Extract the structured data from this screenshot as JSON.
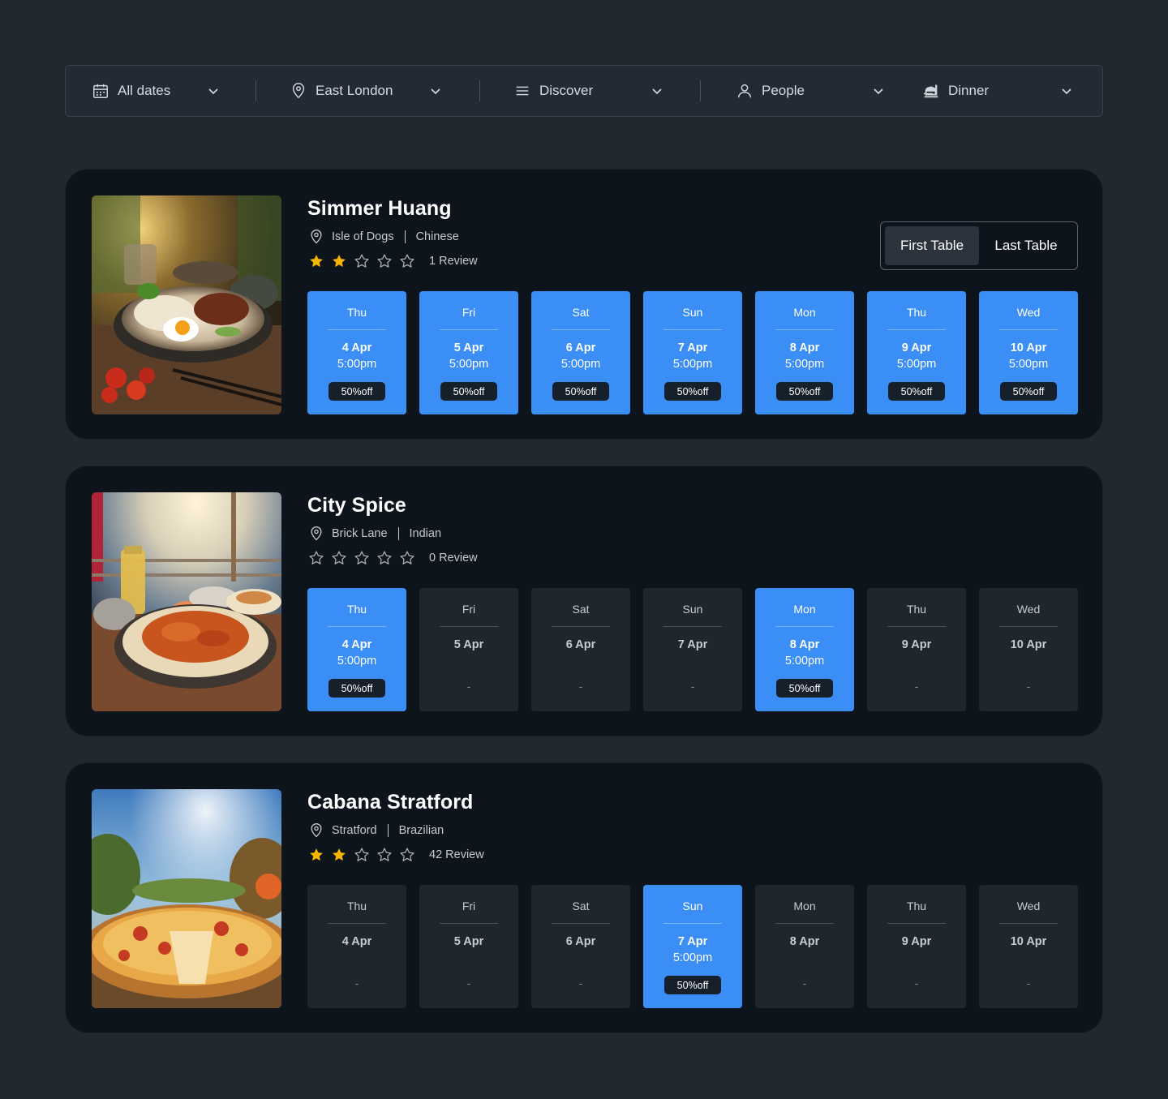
{
  "filters": [
    {
      "label": "All dates",
      "icon": "calendar-icon"
    },
    {
      "label": "East London",
      "icon": "location-pin-icon"
    },
    {
      "label": "Discover",
      "icon": "menu-icon"
    },
    {
      "label": "People",
      "icon": "person-icon"
    },
    {
      "label": "Dinner",
      "icon": "food-tray-icon"
    }
  ],
  "colors": {
    "background": "#212830",
    "card": "#0e141c",
    "accent": "#3a8ef5",
    "slot_unavailable": "#1f262e",
    "star_filled": "#f5b400"
  },
  "toggle": {
    "first": "First Table",
    "last": "Last Table",
    "active": "first"
  },
  "restaurants": [
    {
      "name": "Simmer Huang",
      "area": "Isle of Dogs",
      "cuisine": "Chinese",
      "rating": 2,
      "reviews": "1 Review",
      "image": "rice-bowl-egg-photo",
      "slots": [
        {
          "day": "Thu",
          "date": "4 Apr",
          "time": "5:00pm",
          "offer": "50%off"
        },
        {
          "day": "Fri",
          "date": "5 Apr",
          "time": "5:00pm",
          "offer": "50%off"
        },
        {
          "day": "Sat",
          "date": "6 Apr",
          "time": "5:00pm",
          "offer": "50%off"
        },
        {
          "day": "Sun",
          "date": "7 Apr",
          "time": "5:00pm",
          "offer": "50%off"
        },
        {
          "day": "Mon",
          "date": "8 Apr",
          "time": "5:00pm",
          "offer": "50%off"
        },
        {
          "day": "Thu",
          "date": "9 Apr",
          "time": "5:00pm",
          "offer": "50%off"
        },
        {
          "day": "Wed",
          "date": "10 Apr",
          "time": "5:00pm",
          "offer": "50%off"
        }
      ]
    },
    {
      "name": "City Spice",
      "area": "Brick Lane",
      "cuisine": "Indian",
      "rating": 0,
      "reviews": "0 Review",
      "image": "curry-naan-photo",
      "slots": [
        {
          "day": "Thu",
          "date": "4 Apr",
          "time": "5:00pm",
          "offer": "50%off"
        },
        {
          "day": "Fri",
          "date": "5 Apr",
          "empty": "-"
        },
        {
          "day": "Sat",
          "date": "6 Apr",
          "empty": "-"
        },
        {
          "day": "Sun",
          "date": "7 Apr",
          "empty": "-"
        },
        {
          "day": "Mon",
          "date": "8 Apr",
          "time": "5:00pm",
          "offer": "50%off"
        },
        {
          "day": "Thu",
          "date": "9 Apr",
          "empty": "-"
        },
        {
          "day": "Wed",
          "date": "10 Apr",
          "empty": "-"
        }
      ]
    },
    {
      "name": "Cabana Stratford",
      "area": "Stratford",
      "cuisine": "Brazilian",
      "rating": 2,
      "reviews": "42 Review",
      "image": "pizza-photo",
      "slots": [
        {
          "day": "Thu",
          "date": "4 Apr",
          "empty": "-"
        },
        {
          "day": "Fri",
          "date": "5 Apr",
          "empty": "-"
        },
        {
          "day": "Sat",
          "date": "6 Apr",
          "empty": "-"
        },
        {
          "day": "Sun",
          "date": "7 Apr",
          "time": "5:00pm",
          "offer": "50%off"
        },
        {
          "day": "Mon",
          "date": "8 Apr",
          "empty": "-"
        },
        {
          "day": "Thu",
          "date": "9 Apr",
          "empty": "-"
        },
        {
          "day": "Wed",
          "date": "10 Apr",
          "empty": "-"
        }
      ]
    }
  ]
}
